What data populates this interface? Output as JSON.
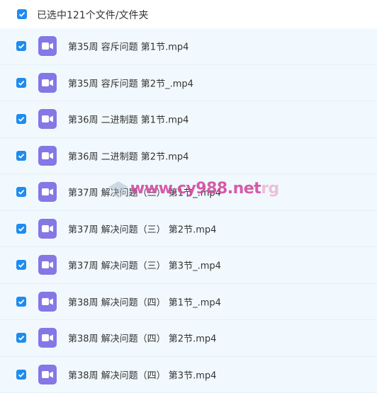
{
  "header": {
    "selection_text": "已选中121个文件/文件夹"
  },
  "files": [
    {
      "name": "第35周 容斥问题 第1节.mp4"
    },
    {
      "name": "第35周 容斥问题 第2节_.mp4"
    },
    {
      "name": "第36周 二进制题 第1节.mp4"
    },
    {
      "name": "第36周 二进制题 第2节.mp4"
    },
    {
      "name": "第37周 解决问题（三） 第1节_.mp4"
    },
    {
      "name": "第37周 解决问题（三） 第2节.mp4"
    },
    {
      "name": "第37周 解决问题（三） 第3节_.mp4"
    },
    {
      "name": "第38周 解决问题（四） 第1节_.mp4"
    },
    {
      "name": "第38周 解决问题（四） 第2节.mp4"
    },
    {
      "name": "第38周 解决问题（四） 第3节.mp4"
    }
  ],
  "watermark": {
    "text": "www.cy988.net",
    "tail": "rg"
  },
  "colors": {
    "checkbox": "#1e8cf0",
    "video_icon": "#8477e6",
    "row_bg": "#f2f9fe"
  }
}
